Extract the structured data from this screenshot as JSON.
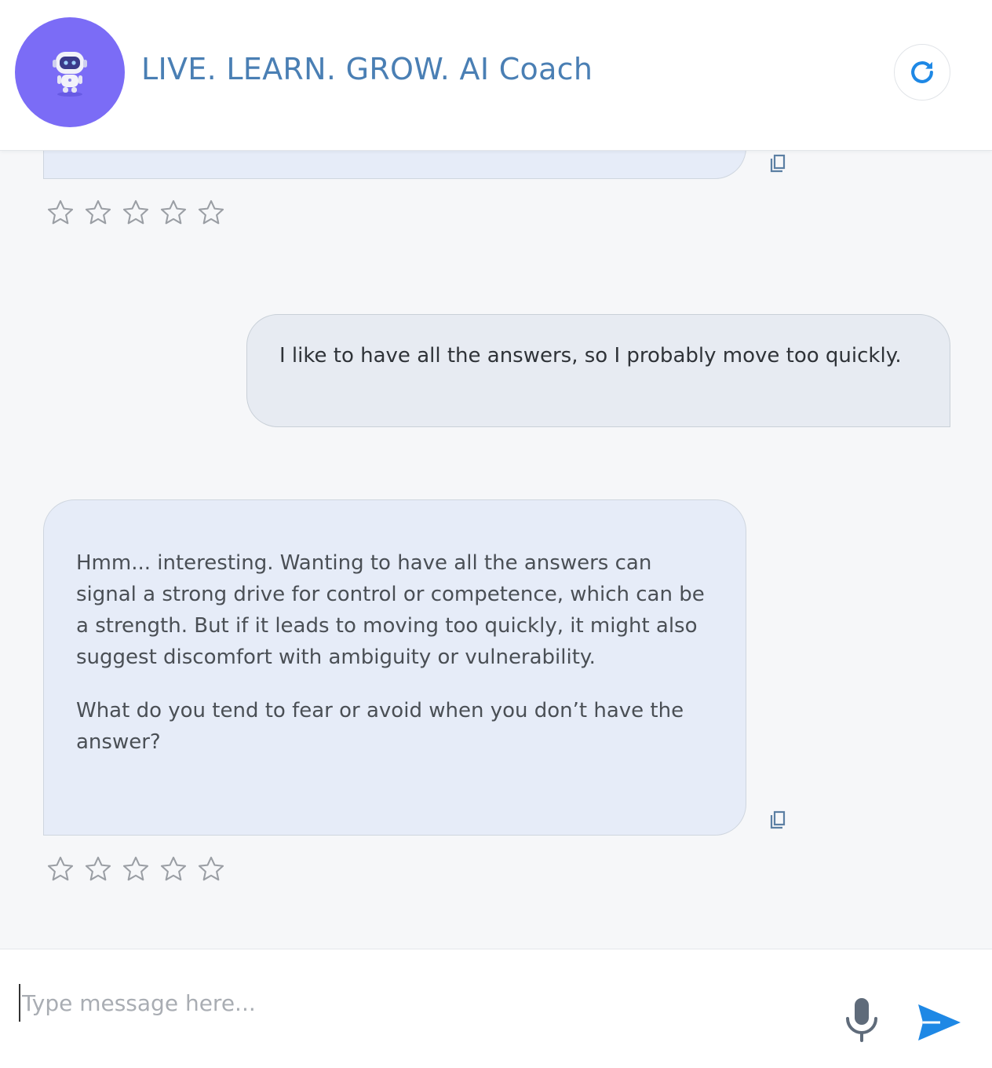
{
  "header": {
    "title": "LIVE. LEARN. GROW. AI Coach",
    "avatar_icon": "robot-icon",
    "refresh_icon": "refresh-icon",
    "colors": {
      "avatar_bg": "#7b6cf6",
      "title": "#4a7fb4",
      "accent": "#1e88e5"
    }
  },
  "messages": [
    {
      "role": "assistant",
      "partial": true,
      "rating": 0,
      "rating_max": 5
    },
    {
      "role": "user",
      "text": "I like to have all the answers, so I probably move too quickly."
    },
    {
      "role": "assistant",
      "paragraphs": [
        "Hmm... interesting. Wanting to have all the answers can signal a strong drive for control or competence, which can be a strength. But if it leads to moving too quickly, it might also suggest discomfort with ambiguity or vulnerability.",
        "What do you tend to fear or avoid when you don’t have the answer?"
      ],
      "rating": 0,
      "rating_max": 5
    }
  ],
  "composer": {
    "placeholder": "Type message here...",
    "value": "",
    "mic_icon": "microphone-icon",
    "send_icon": "send-icon"
  }
}
